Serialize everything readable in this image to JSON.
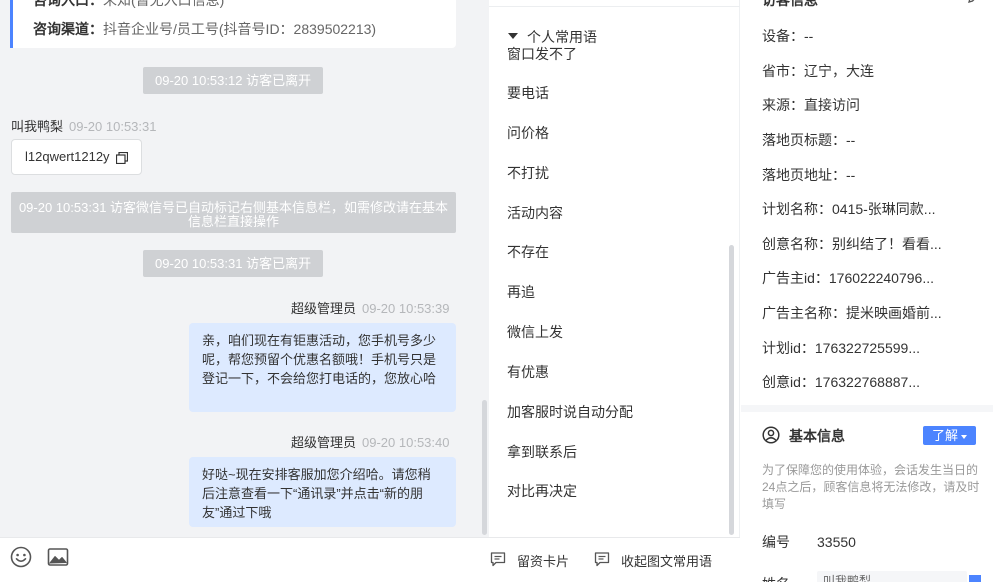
{
  "chat": {
    "info_card": {
      "row1_label": "咨询入口：",
      "row1_value": "未知(暂无入口信息)",
      "row2_label": "咨询渠道：",
      "row2_value": "抖音企业号/员工号(抖音号ID：2839502213)"
    },
    "sys_left_1": "09-20 10:53:12 访客已离开",
    "visitor_name": "叫我鸭梨",
    "visitor_time": "09-20 10:53:31",
    "visitor_message": "l12qwert1212y",
    "sys_wechat_notice": "09-20 10:53:31 访客微信号已自动标记右侧基本信息栏，如需修改请在基本信息栏直接操作",
    "sys_left_2": "09-20 10:53:31 访客已离开",
    "agent1_name": "超级管理员",
    "agent1_time": "09-20 10:53:39",
    "agent1_message": "亲，咱们现在有钜惠活动，您手机号多少呢，帮您预留个优惠名额哦！手机号只是登记一下，不会给您打电话的，您放心哈",
    "agent2_name": "超级管理员",
    "agent2_time": "09-20 10:53:40",
    "agent2_message": "好哒~现在安排客服加您介绍哈。请您稍后注意查看一下“通讯录”并点击“新的朋友”通过下哦"
  },
  "footer": {
    "emoji_icon": "smile-icon",
    "image_icon": "image-icon",
    "card_label": "留资卡片",
    "collapse_label": "收起图文常用语"
  },
  "phrases": {
    "group_label": "个人常用语",
    "items": [
      "窗口发不了",
      "要电话",
      "问价格",
      "不打扰",
      "活动内容",
      "不存在",
      "再追",
      "微信上发",
      "有优惠",
      "加客服时说自动分配",
      "拿到联系后",
      "对比再决定"
    ]
  },
  "info": {
    "top_title": "访客信息",
    "rows": [
      "设备：--",
      "省市：辽宁，大连",
      "来源：直接访问",
      "落地页标题：--",
      "落地页地址：--",
      "计划名称：0415-张琳同款...",
      "创意名称：别纠结了！看看...",
      "广告主id：176022240796...",
      "广告主名称：提米映画婚前...",
      "计划id：176322725599...",
      "创意id：176322768887..."
    ],
    "basic_title": "基本信息",
    "learn_label": "了解",
    "note": "为了保障您的使用体验，会话发生当日的24点之后，顾客信息将无法修改，请及时填写",
    "id_label": "编号",
    "id_value": "33550",
    "partial_label": "姓名",
    "partial_value": "叫我鸭梨"
  },
  "colors": {
    "accent": "#4c84ff",
    "agent_bubble": "#ddeaff",
    "system_pill": "#cfd1d4",
    "chat_bg": "#f2f3f5"
  }
}
